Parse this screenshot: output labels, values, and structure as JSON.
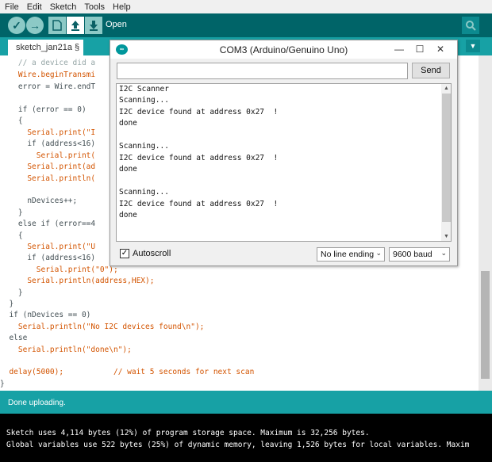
{
  "menu": {
    "items": [
      "File",
      "Edit",
      "Sketch",
      "Tools",
      "Help"
    ]
  },
  "toolbar": {
    "verify_icon": "checkmark-icon",
    "upload_icon": "arrow-right-icon",
    "new_icon": "new-file-icon",
    "open_icon": "open-arrow-icon",
    "save_icon": "save-arrow-icon",
    "hover_label": "Open",
    "serial_icon": "magnifier-icon"
  },
  "tabs": {
    "active": "sketch_jan21a §",
    "menu_icon": "chevron-down-icon"
  },
  "editor": {
    "lines": [
      "    // a device did a",
      "    Wire.beginTransmi",
      "    error = Wire.endT",
      "",
      "    if (error == 0)",
      "    {",
      "      Serial.print(\"I",
      "      if (address<16)",
      "        Serial.print(",
      "      Serial.print(ad",
      "      Serial.println(",
      "",
      "      nDevices++;",
      "    }",
      "    else if (error==4",
      "    {",
      "      Serial.print(\"U",
      "      if (address<16)",
      "        Serial.print(\"0\");",
      "      Serial.println(address,HEX);",
      "    }",
      "  }",
      "  if (nDevices == 0)",
      "    Serial.println(\"No I2C devices found\\n\");",
      "  else",
      "    Serial.println(\"done\\n\");",
      "",
      "  delay(5000);           // wait 5 seconds for next scan",
      "}"
    ]
  },
  "status": {
    "text": "Done uploading."
  },
  "console": {
    "lines": [
      "Sketch uses 4,114 bytes (12%) of program storage space. Maximum is 32,256 bytes.",
      "Global variables use 522 bytes (25%) of dynamic memory, leaving 1,526 bytes for local variables. Maxim"
    ]
  },
  "serial_monitor": {
    "title": "COM3 (Arduino/Genuino Uno)",
    "minimize": "—",
    "maximize": "☐",
    "close": "✕",
    "input_value": "",
    "send_label": "Send",
    "output_lines": [
      "I2C Scanner",
      "Scanning...",
      "I2C device found at address 0x27  !",
      "done",
      "",
      "Scanning...",
      "I2C device found at address 0x27  !",
      "done",
      "",
      "Scanning...",
      "I2C device found at address 0x27  !",
      "done"
    ],
    "autoscroll_label": "Autoscroll",
    "autoscroll_checked": true,
    "line_ending": "No line ending",
    "baud": "9600 baud"
  },
  "colors": {
    "toolbar": "#006468",
    "tabrow": "#17a1a5",
    "keyword": "#d35400",
    "function": "#00979c"
  }
}
